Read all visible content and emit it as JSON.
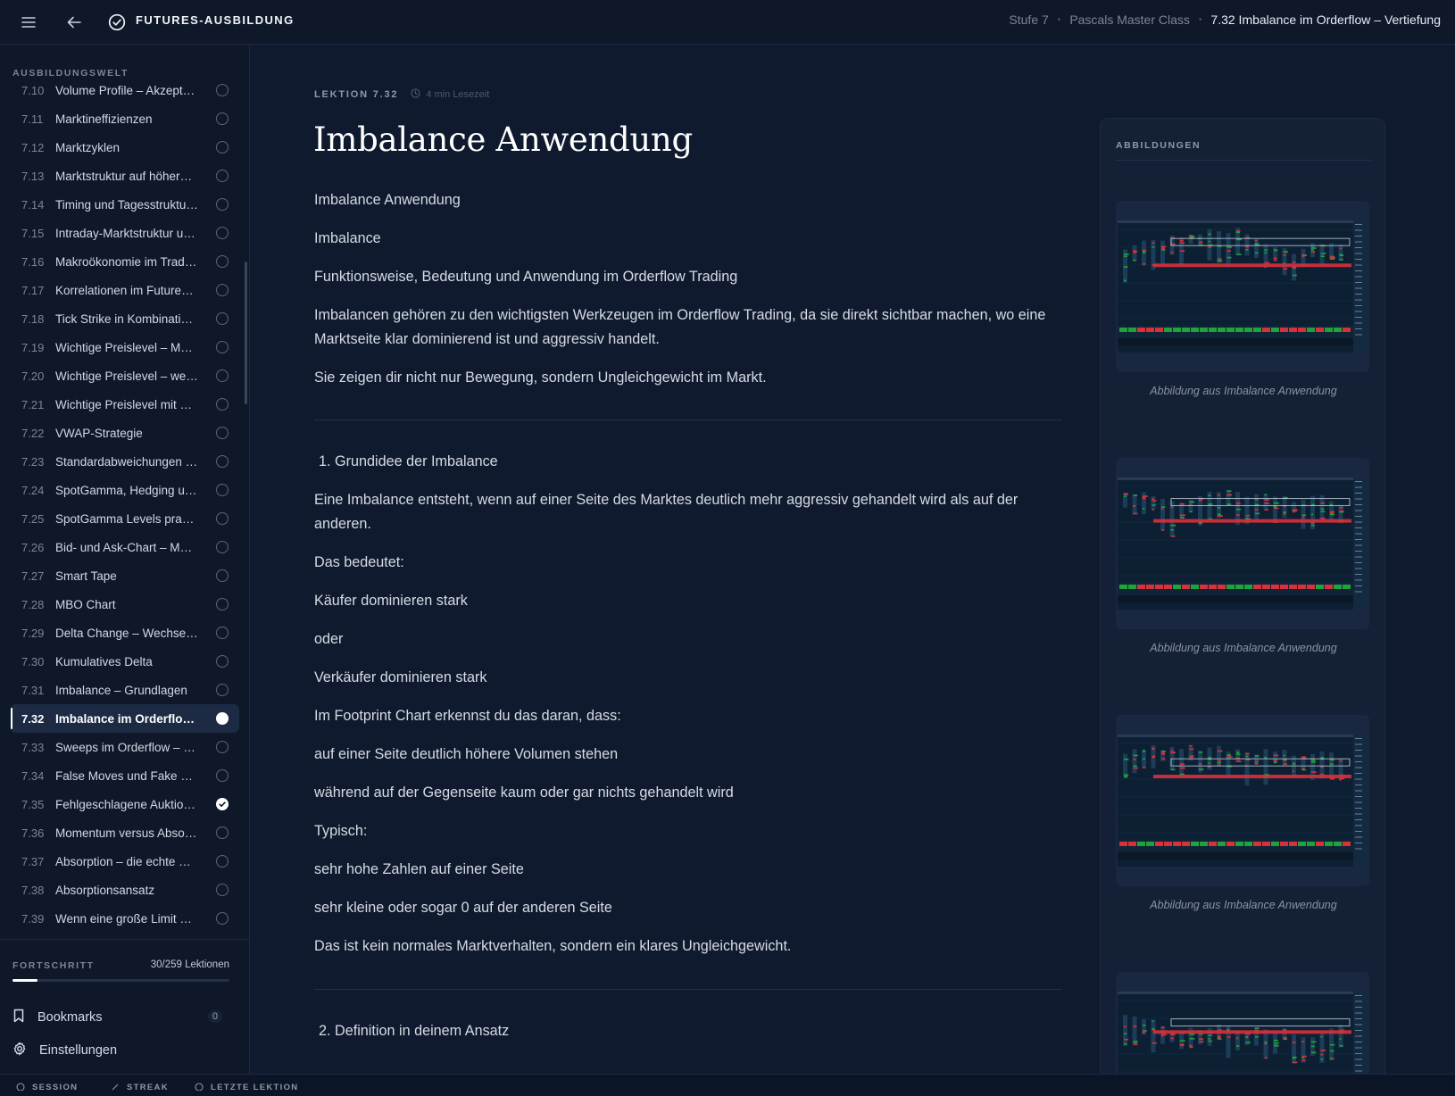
{
  "topbar": {
    "brand": "FUTURES-AUSBILDUNG",
    "breadcrumbs": [
      "Stufe 7",
      "Pascals Master Class",
      "7.32 Imbalance im Orderflow – Vertiefung"
    ]
  },
  "sidebar": {
    "section_label": "AUSBILDUNGSWELT",
    "lessons": [
      {
        "num": "7.10",
        "name": "Volume Profile – Akzeptanz",
        "status": "open"
      },
      {
        "num": "7.11",
        "name": "Marktineffizienzen",
        "status": "open"
      },
      {
        "num": "7.12",
        "name": "Marktzyklen",
        "status": "open"
      },
      {
        "num": "7.13",
        "name": "Marktstruktur auf höheren Zeiteinheiten",
        "status": "open"
      },
      {
        "num": "7.14",
        "name": "Timing und Tagesstruktur im Handel",
        "status": "open"
      },
      {
        "num": "7.15",
        "name": "Intraday-Marktstruktur und Ablauf",
        "status": "open"
      },
      {
        "num": "7.16",
        "name": "Makroökonomie im Trading",
        "status": "open"
      },
      {
        "num": "7.17",
        "name": "Korrelationen im Futures-Markt",
        "status": "open"
      },
      {
        "num": "7.18",
        "name": "Tick Strike in Kombination mit Orderflow",
        "status": "open"
      },
      {
        "num": "7.19",
        "name": "Wichtige Preislevel – Markieren",
        "status": "open"
      },
      {
        "num": "7.20",
        "name": "Wichtige Preislevel – welche zählen",
        "status": "open"
      },
      {
        "num": "7.21",
        "name": "Wichtige Preislevel mit dem Orderflow",
        "status": "open"
      },
      {
        "num": "7.22",
        "name": "VWAP-Strategie",
        "status": "open"
      },
      {
        "num": "7.23",
        "name": "Standardabweichungen am VWAP",
        "status": "open"
      },
      {
        "num": "7.24",
        "name": "SpotGamma, Hedging und Optionen",
        "status": "open"
      },
      {
        "num": "7.25",
        "name": "SpotGamma Levels praktisch nutzen",
        "status": "open"
      },
      {
        "num": "7.26",
        "name": "Bid- und Ask-Chart – Mechanik",
        "status": "open"
      },
      {
        "num": "7.27",
        "name": "Smart Tape",
        "status": "open"
      },
      {
        "num": "7.28",
        "name": "MBO Chart",
        "status": "open"
      },
      {
        "num": "7.29",
        "name": "Delta Change – Wechsel im Delta",
        "status": "open"
      },
      {
        "num": "7.30",
        "name": "Kumulatives Delta",
        "status": "open"
      },
      {
        "num": "7.31",
        "name": "Imbalance – Grundlagen",
        "status": "open"
      },
      {
        "num": "7.32",
        "name": "Imbalance im Orderflow – Vertiefung",
        "status": "active"
      },
      {
        "num": "7.33",
        "name": "Sweeps im Orderflow – Verstehen",
        "status": "open"
      },
      {
        "num": "7.34",
        "name": "False Moves und Fake Breakouts",
        "status": "open"
      },
      {
        "num": "7.35",
        "name": "Fehlgeschlagene Auktionen",
        "status": "done"
      },
      {
        "num": "7.36",
        "name": "Momentum versus Absorption",
        "status": "open"
      },
      {
        "num": "7.37",
        "name": "Absorption – die echte Marktkraft",
        "status": "open"
      },
      {
        "num": "7.38",
        "name": "Absorptionsansatz",
        "status": "open"
      },
      {
        "num": "7.39",
        "name": "Wenn eine große Limit Order steht",
        "status": "open"
      }
    ],
    "progress": {
      "label": "FORTSCHRITT",
      "count": "30/259 Lektionen",
      "fraction": 0.116
    },
    "bookmarks": {
      "label": "Bookmarks",
      "count": "0"
    },
    "settings": {
      "label": "Einstellungen"
    }
  },
  "footer": {
    "items": [
      "SESSION",
      "STREAK",
      "LETZTE LEKTION"
    ]
  },
  "article": {
    "lesson_tag": "LEKTION 7.32",
    "read_time": "4 min Lesezeit",
    "title": "Imbalance Anwendung",
    "intro": [
      "Imbalance Anwendung",
      "Imbalance",
      "Funktionsweise, Bedeutung und Anwendung im Orderflow Trading",
      "Imbalancen gehören zu den wichtigsten Werkzeugen im Orderflow Trading, da sie direkt sichtbar machen, wo eine Marktseite klar dominierend ist und aggressiv handelt.",
      "Sie zeigen dir nicht nur Bewegung, sondern Ungleichgewicht im Markt."
    ],
    "section1_title": "1. Grundidee der Imbalance",
    "section1": [
      "Eine Imbalance entsteht, wenn auf einer Seite des Marktes deutlich mehr aggressiv gehandelt wird als auf der anderen.",
      "Das bedeutet:",
      "Käufer dominieren stark",
      "oder",
      "Verkäufer dominieren stark",
      "Im Footprint Chart erkennst du das daran, dass:",
      "auf einer Seite deutlich höhere Volumen stehen",
      "während auf der Gegenseite kaum oder gar nichts gehandelt wird",
      "Typisch:",
      "sehr hohe Zahlen auf einer Seite",
      "sehr kleine oder sogar 0 auf der anderen Seite",
      "Das ist kein normales Marktverhalten, sondern ein klares Ungleichgewicht."
    ],
    "section2_title": "2. Definition in deinem Ansatz"
  },
  "figures": {
    "label": "ABBILDUNGEN",
    "captions": [
      "Abbildung aus Imbalance Anwendung",
      "Abbildung aus Imbalance Anwendung",
      "Abbildung aus Imbalance Anwendung"
    ]
  },
  "colors": {
    "background": "#101a2e",
    "panel": "#0e1829",
    "accent": "#ffffff",
    "chart_red": "#d9303a",
    "chart_green": "#1fa33a"
  }
}
